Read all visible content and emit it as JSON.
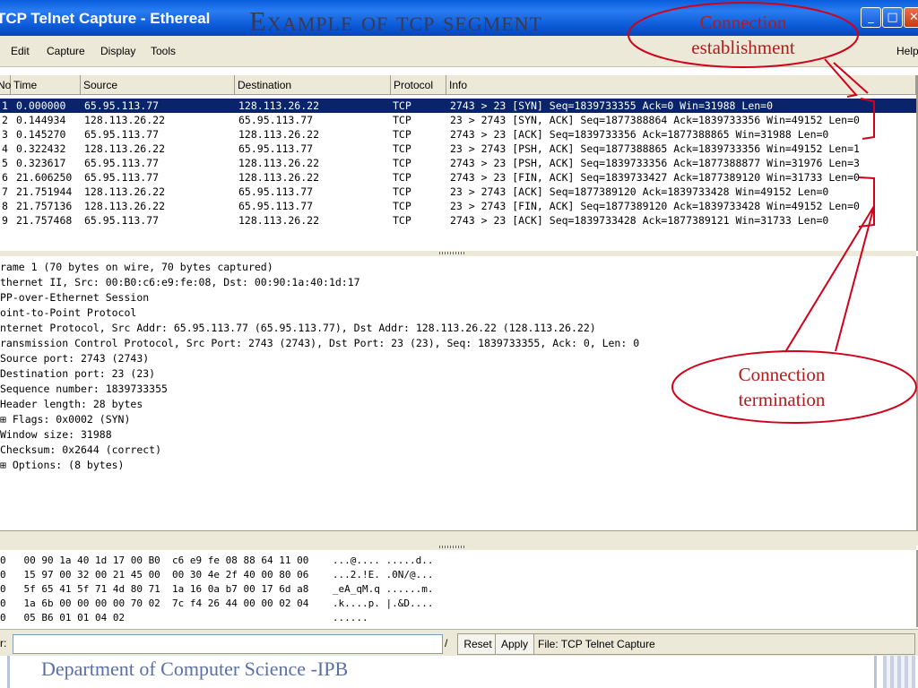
{
  "window": {
    "title": "TCP Telnet Capture - Ethereal",
    "buttons": {
      "minimize": "_",
      "maximize": "□",
      "close": "✕"
    }
  },
  "slide": {
    "title": "Example of tcp segment",
    "footer": "Department of Computer Science -IPB"
  },
  "menu": {
    "items": [
      "Edit",
      "Capture",
      "Display",
      "Tools"
    ],
    "help": "Help"
  },
  "packet_list": {
    "columns": [
      "No.",
      "Time",
      "Source",
      "Destination",
      "Protocol",
      "Info"
    ],
    "rows": [
      {
        "no": "1",
        "time": "0.000000",
        "src": "65.95.113.77",
        "dst": "128.113.26.22",
        "proto": "TCP",
        "info": "2743 > 23 [SYN] Seq=1839733355 Ack=0 Win=31988 Len=0"
      },
      {
        "no": "2",
        "time": "0.144934",
        "src": "128.113.26.22",
        "dst": "65.95.113.77",
        "proto": "TCP",
        "info": "23 > 2743 [SYN, ACK] Seq=1877388864 Ack=1839733356 Win=49152 Len=0"
      },
      {
        "no": "3",
        "time": "0.145270",
        "src": "65.95.113.77",
        "dst": "128.113.26.22",
        "proto": "TCP",
        "info": "2743 > 23 [ACK] Seq=1839733356 Ack=1877388865 Win=31988 Len=0"
      },
      {
        "no": "4",
        "time": "0.322432",
        "src": "128.113.26.22",
        "dst": "65.95.113.77",
        "proto": "TCP",
        "info": "23 > 2743 [PSH, ACK] Seq=1877388865 Ack=1839733356 Win=49152 Len=1"
      },
      {
        "no": "5",
        "time": "0.323617",
        "src": "65.95.113.77",
        "dst": "128.113.26.22",
        "proto": "TCP",
        "info": "2743 > 23 [PSH, ACK] Seq=1839733356 Ack=1877388877 Win=31976 Len=3"
      },
      {
        "no": "6",
        "time": "21.606250",
        "src": "65.95.113.77",
        "dst": "128.113.26.22",
        "proto": "TCP",
        "info": "2743 > 23 [FIN, ACK] Seq=1839733427 Ack=1877389120 Win=31733 Len=0"
      },
      {
        "no": "7",
        "time": "21.751944",
        "src": "128.113.26.22",
        "dst": "65.95.113.77",
        "proto": "TCP",
        "info": "23 > 2743 [ACK] Seq=1877389120 Ack=1839733428 Win=49152 Len=0"
      },
      {
        "no": "8",
        "time": "21.757136",
        "src": "128.113.26.22",
        "dst": "65.95.113.77",
        "proto": "TCP",
        "info": "23 > 2743 [FIN, ACK] Seq=1877389120 Ack=1839733428 Win=49152 Len=0"
      },
      {
        "no": "9",
        "time": "21.757468",
        "src": "65.95.113.77",
        "dst": "128.113.26.22",
        "proto": "TCP",
        "info": "2743 > 23 [ACK] Seq=1839733428 Ack=1877389121 Win=31733 Len=0"
      }
    ]
  },
  "detail": {
    "lines": [
      "rame 1 (70 bytes on wire, 70 bytes captured)",
      "thernet II, Src: 00:B0:c6:e9:fe:08, Dst: 00:90:1a:40:1d:17",
      "PP-over-Ethernet Session",
      "oint-to-Point Protocol",
      "nternet Protocol, Src Addr: 65.95.113.77 (65.95.113.77), Dst Addr: 128.113.26.22 (128.113.26.22)",
      "ransmission Control Protocol, Src Port: 2743 (2743), Dst Port: 23 (23), Seq: 1839733355, Ack: 0, Len: 0",
      "  Source port: 2743 (2743)",
      "  Destination port: 23 (23)",
      "  Sequence number: 1839733355",
      "  Header length: 28 bytes",
      "⊞ Flags: 0x0002 (SYN)",
      "  Window size: 31988",
      "  Checksum: 0x2644 (correct)",
      "⊞ Options: (8 bytes)"
    ]
  },
  "hex": {
    "lines": [
      "0   00 90 1a 40 1d 17 00 B0  c6 e9 fe 08 88 64 11 00    ...@.... .....d..",
      "0   15 97 00 32 00 21 45 00  00 30 4e 2f 40 00 80 06    ...2.!E. .0N/@...",
      "0   5f 65 41 5f 71 4d 80 71  1a 16 0a b7 00 17 6d a8    _eA_qM.q ......m.",
      "0   1a 6b 00 00 00 00 70 02  7c f4 26 44 00 00 02 04    .k....p. |.&D....",
      "0   05 B6 01 01 04 02                                   ......"
    ]
  },
  "statusbar": {
    "filter_label": "r:",
    "filter_value": "",
    "dropdown_glyph": "/",
    "reset": "Reset",
    "apply": "Apply",
    "file": "File: TCP Telnet Capture"
  },
  "annotations": {
    "establishment": {
      "line1": "Connection",
      "line2": "establishment"
    },
    "termination": {
      "line1": "Connection",
      "line2": "termination"
    }
  },
  "colors": {
    "titlebar": "#0a5ede",
    "selected_row": "#0a246a",
    "annotation": "#d0021b",
    "footer_text": "#5a6fa8"
  }
}
